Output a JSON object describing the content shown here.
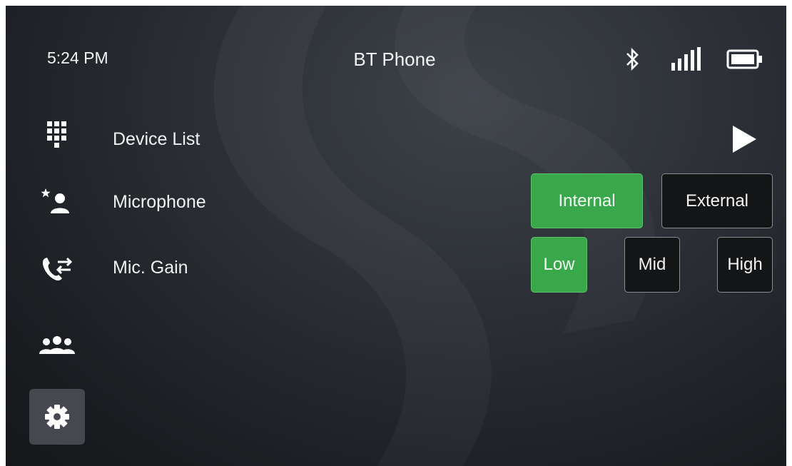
{
  "status_bar": {
    "time": "5:24 PM",
    "title": "BT Phone",
    "icons": [
      "bluetooth-icon",
      "signal-strength-icon",
      "battery-icon"
    ]
  },
  "sidebar": {
    "items": [
      {
        "name": "dialpad-icon",
        "active": false
      },
      {
        "name": "favorite-contact-icon",
        "active": false
      },
      {
        "name": "call-transfer-icon",
        "active": false
      },
      {
        "name": "contacts-group-icon",
        "active": false
      },
      {
        "name": "settings-gear-icon",
        "active": true
      }
    ]
  },
  "settings": {
    "device_list": {
      "label": "Device List",
      "action_icon": "play-arrow-icon"
    },
    "microphone": {
      "label": "Microphone",
      "options": [
        {
          "label": "Internal",
          "selected": true
        },
        {
          "label": "External",
          "selected": false
        }
      ]
    },
    "mic_gain": {
      "label": "Mic. Gain",
      "options": [
        {
          "label": "Low",
          "selected": true
        },
        {
          "label": "Mid",
          "selected": false
        },
        {
          "label": "High",
          "selected": false
        }
      ]
    }
  },
  "colors": {
    "selected": "#38a84b",
    "unselected": "#141517",
    "text": "#f2f2f2"
  }
}
